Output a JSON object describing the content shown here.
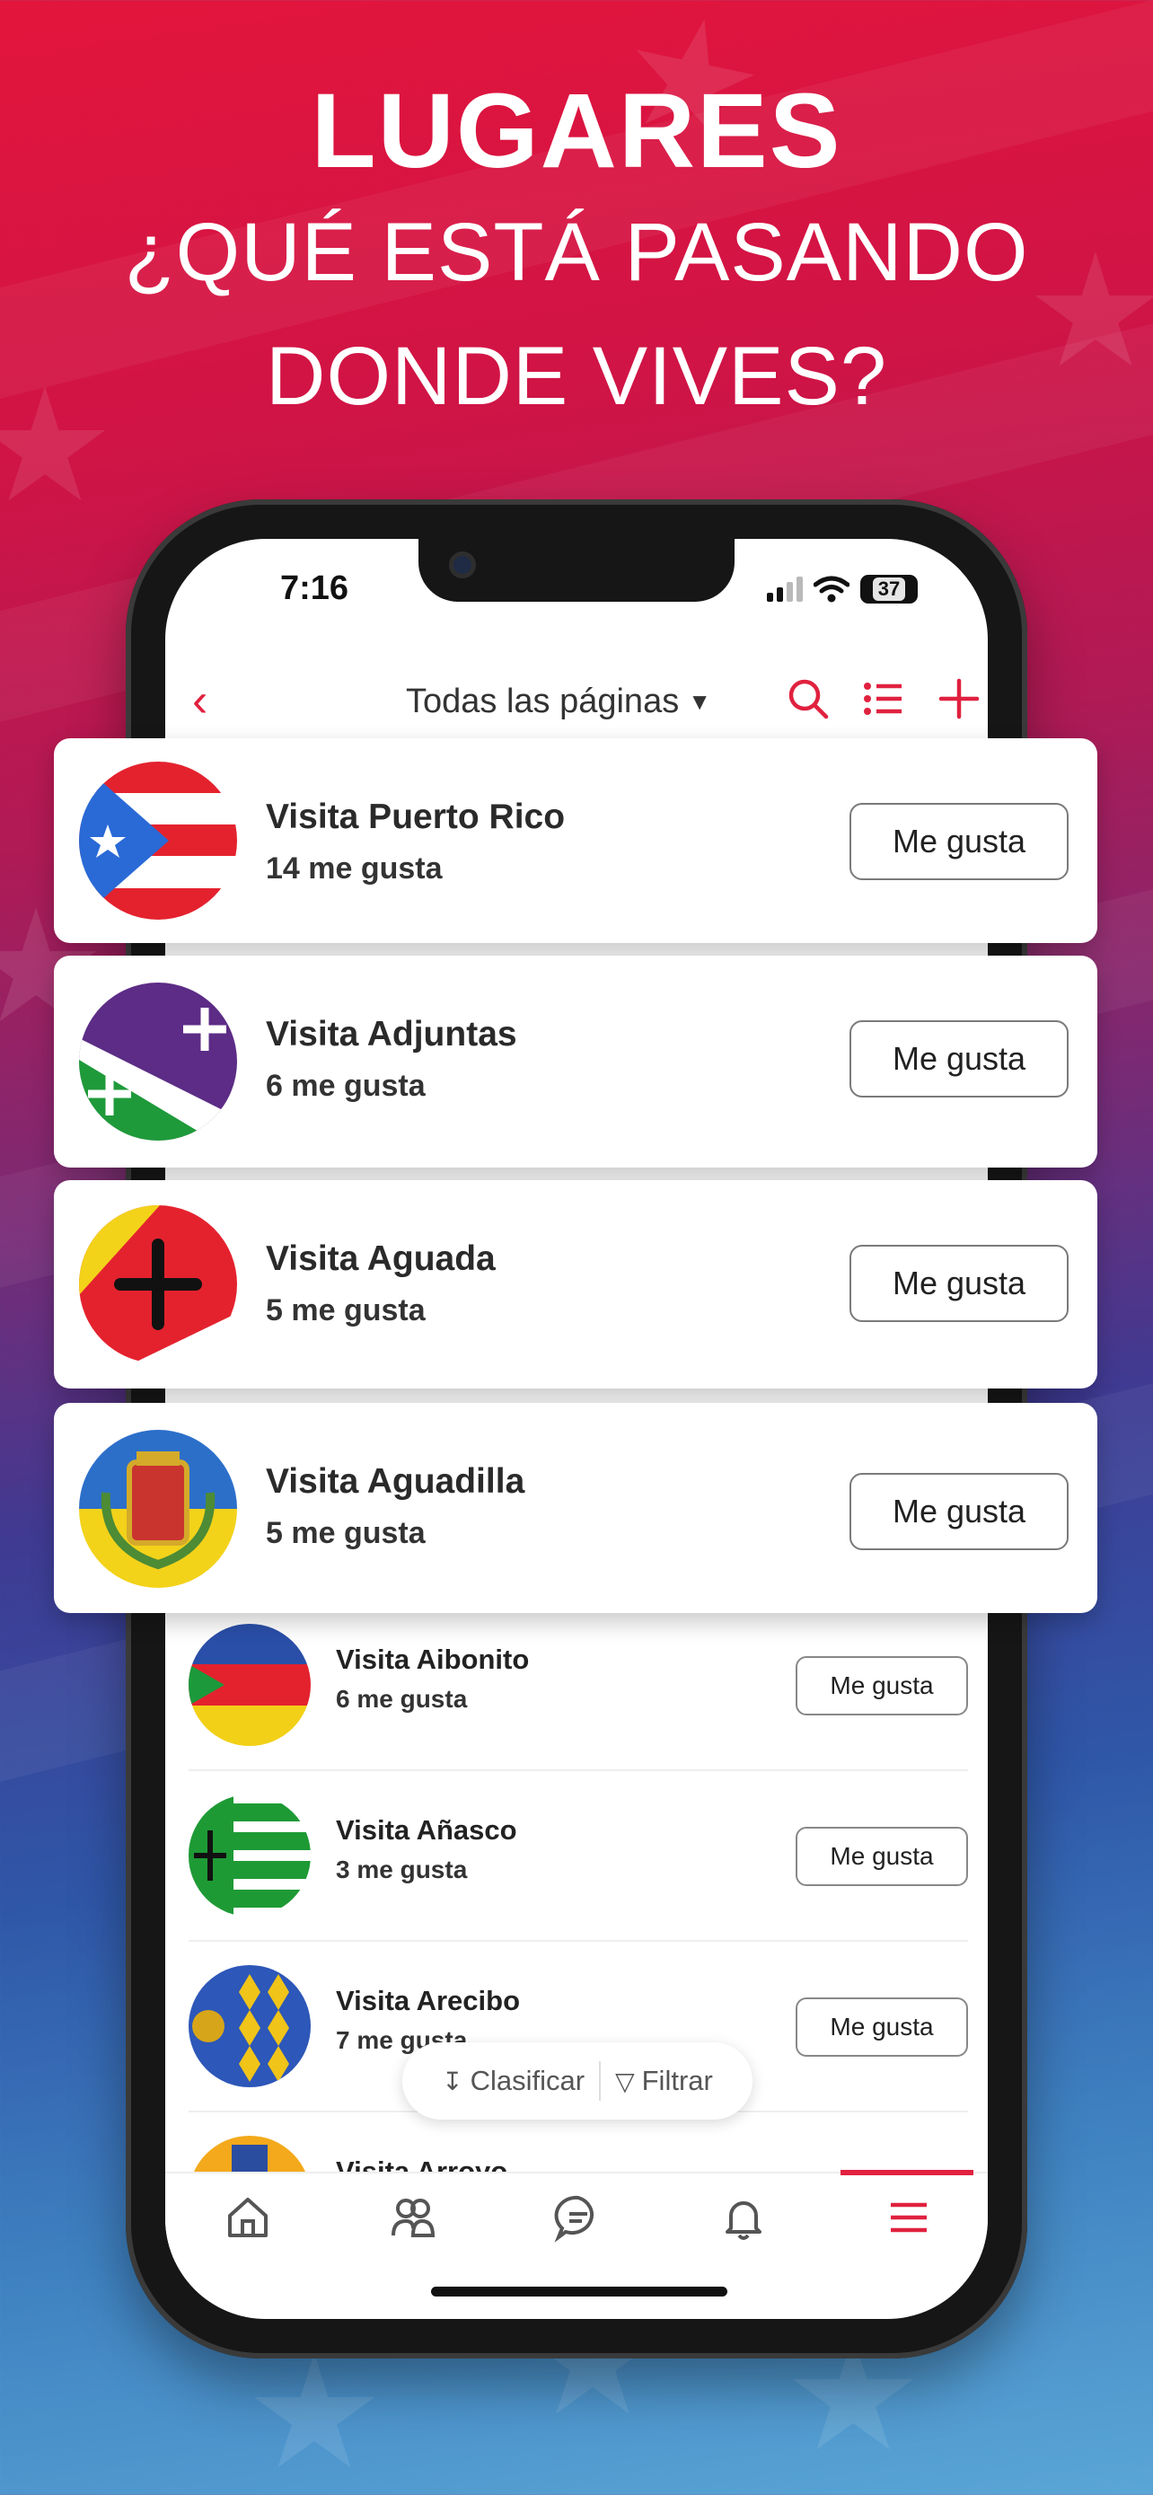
{
  "headline": {
    "title": "LUGARES",
    "line1": "¿QUÉ ESTÁ PASANDO",
    "line2": "DONDE VIVES?"
  },
  "status_bar": {
    "time": "7:16",
    "battery": "37"
  },
  "navbar": {
    "title": "Todas las páginas",
    "icons": [
      "back-chevron-icon",
      "search-icon",
      "list-icon",
      "plus-icon"
    ]
  },
  "featured_pages": [
    {
      "name": "Visita Puerto Rico",
      "likes": "14 me gusta",
      "button": "Me gusta"
    },
    {
      "name": "Visita Adjuntas",
      "likes": "6 me gusta",
      "button": "Me gusta"
    },
    {
      "name": "Visita Aguada",
      "likes": "5 me gusta",
      "button": "Me gusta"
    },
    {
      "name": "Visita Aguadilla",
      "likes": "5 me gusta",
      "button": "Me gusta"
    }
  ],
  "list_pages": [
    {
      "name": "Visita Aibonito",
      "likes": "6 me gusta",
      "button": "Me gusta"
    },
    {
      "name": "Visita Añasco",
      "likes": "3 me gusta",
      "button": "Me gusta"
    },
    {
      "name": "Visita Arecibo",
      "likes": "7 me gusta",
      "button": "Me gusta"
    },
    {
      "name": "Visita Arroyo",
      "likes": "",
      "button": ""
    }
  ],
  "floating_pill": {
    "sort": "Clasificar",
    "filter": "Filtrar"
  },
  "tabbar": {
    "tabs": [
      "home-icon",
      "people-icon",
      "chat-icon",
      "bell-icon",
      "menu-icon"
    ],
    "active": "menu-icon"
  },
  "colors": {
    "accent": "#e0213f"
  }
}
